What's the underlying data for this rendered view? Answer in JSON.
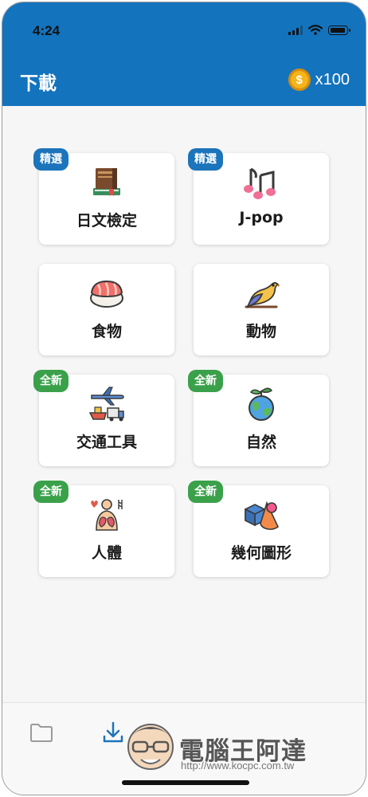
{
  "status_bar": {
    "time": "4:24"
  },
  "header": {
    "title": "下載",
    "coin_count": "x100",
    "coin_symbol": "$"
  },
  "categories": [
    {
      "label": "日文檢定",
      "badge": "精選",
      "badge_color": "#1c74bb",
      "icon": "books-icon"
    },
    {
      "label": "J-pop",
      "badge": "精選",
      "badge_color": "#1c74bb",
      "icon": "music-notes-icon"
    },
    {
      "label": "食物",
      "badge": "",
      "icon": "sushi-icon"
    },
    {
      "label": "動物",
      "badge": "",
      "icon": "bird-icon"
    },
    {
      "label": "交通工具",
      "badge": "全新",
      "badge_color": "#3aa14a",
      "icon": "vehicles-icon"
    },
    {
      "label": "自然",
      "badge": "全新",
      "badge_color": "#3aa14a",
      "icon": "earth-plant-icon"
    },
    {
      "label": "人體",
      "badge": "全新",
      "badge_color": "#3aa14a",
      "icon": "human-body-icon"
    },
    {
      "label": "幾何圖形",
      "badge": "全新",
      "badge_color": "#3aa14a",
      "icon": "geometric-shapes-icon"
    }
  ],
  "tab_bar": {
    "items": [
      "folder-icon",
      "download-icon"
    ],
    "active": "download-icon"
  },
  "watermark": {
    "title": "電腦王阿達",
    "url": "http://www.kocpc.com.tw"
  },
  "colors": {
    "header": "#1473bd",
    "badge_featured": "#1c74bb",
    "badge_new": "#3aa14a",
    "coin": "#f4b41a"
  }
}
